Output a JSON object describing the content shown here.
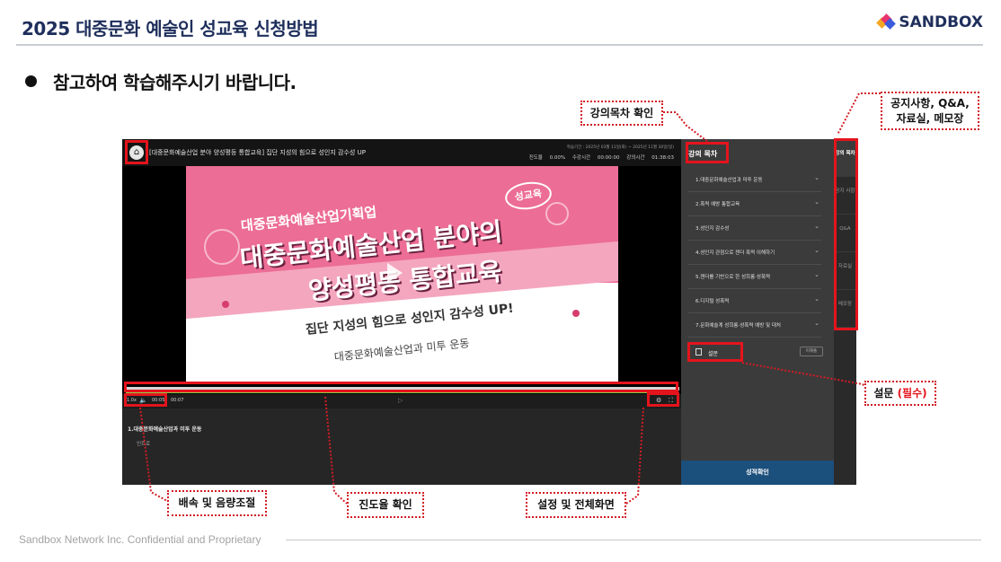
{
  "slide": {
    "title": "2025 대중문화 예술인 성교육 신청방법",
    "bullet": "참고하여 학습해주시기 바랍니다.",
    "footer": "Sandbox Network Inc. Confidential and Proprietary"
  },
  "brand": {
    "logo_text": "SANDBOX",
    "logo_colors": [
      "#f5a623",
      "#e8336d",
      "#3b5bdb"
    ]
  },
  "player": {
    "course_title": "[대중문화예술산업 분야 양성평등 통합교육] 집단 지성의 힘으로 성인지 감수성 UP",
    "learning_period": "학습기간 : 2025년 03월 11일(화) ~ 2025년 11월 30일(일)",
    "progress_rate": "진도율 0.00%",
    "time_watched": "수강시간 00:00:00",
    "lecture_time": "강의시간 01:38:03",
    "speed": "1.0x",
    "current_time": "00:05",
    "duration": "00:07",
    "lesson_title": "1.대중문화예술산업과 미투 운동",
    "lesson_sub": "인트로"
  },
  "poster": {
    "org": "대중문화예술산업기획업",
    "title_line1": "대중문화예술산업 분야의",
    "title_line2": "양성평등 통합교육",
    "tag": "성교육",
    "line1": "집단 지성의 힘으로 성인지 감수성 UP!",
    "line2": "대중문화예술산업과 미투 운동"
  },
  "toc": {
    "heading": "강의 목차",
    "items": [
      "1.대중문화예술산업과 미투 운동",
      "2.폭력 예방 통합교육",
      "3.성인지 감수성",
      "4.성인지 관점으로 젠더 폭력 이해하기",
      "5.젠더를 기반으로 한 성희롱·성폭력",
      "6.디지털 성폭력",
      "7.문화예술계 성희롱·성폭력 예방 및 대처"
    ],
    "survey_label": "설문",
    "survey_status": "미제출",
    "grade_button": "성적확인"
  },
  "side_tabs": [
    "강의 목차",
    "공지 사항",
    "Q&A",
    "자료실",
    "메모장"
  ],
  "callouts": {
    "toc": "강의목차 확인",
    "side": [
      "공지사항, Q&A,",
      "자료실, 메모장"
    ],
    "survey": "설문",
    "survey_required": "(필수)",
    "speed": "배속 및 음량조절",
    "progress": "진도율 확인",
    "settings": "설정 및 전체화면"
  },
  "colors": {
    "highlight": "#e4141c",
    "title": "#1f2f5c",
    "grade_button": "#1b4f7c",
    "poster_pink": "#ec6d95",
    "progress_green": "#8ed14a"
  }
}
